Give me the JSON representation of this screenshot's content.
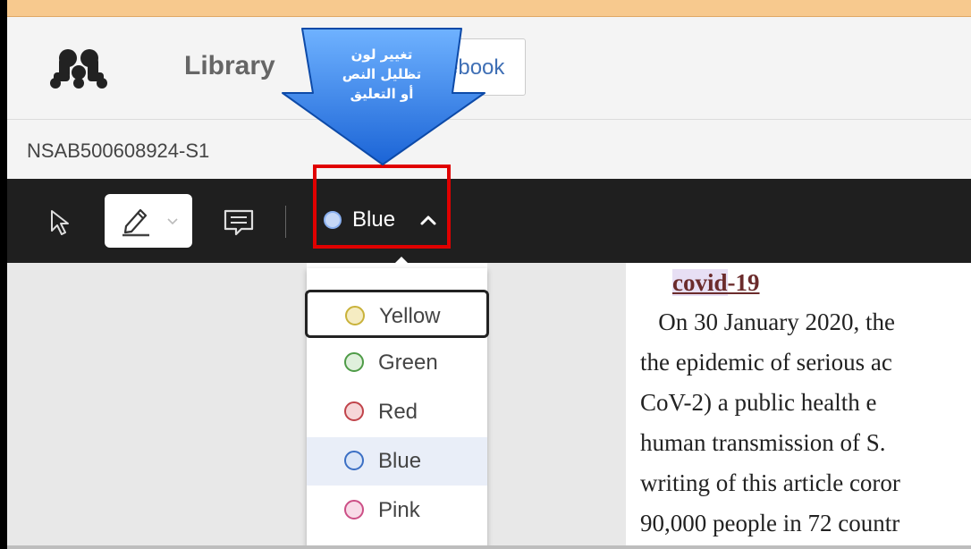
{
  "header": {
    "library_label": "Library",
    "notebook_label": "ebook"
  },
  "document": {
    "id": "NSAB500608924-S1",
    "title_part1": "covid",
    "title_part2": "-19",
    "lines": [
      "   On 30 January 2020, the",
      "the epidemic of serious ac",
      "CoV-2) a public health e",
      "human transmission of S.",
      "writing of this article coror",
      "90,000 people in 72 countr"
    ]
  },
  "toolbar": {
    "color_selected": "Blue",
    "accent_color": "#4f8ff0"
  },
  "color_menu": {
    "items": [
      {
        "label": "Yellow",
        "ring": "#c9b23a",
        "fill": "#f5ecc2"
      },
      {
        "label": "Green",
        "ring": "#4e9b47",
        "fill": "#dff0dc"
      },
      {
        "label": "Red",
        "ring": "#c0434a",
        "fill": "#f6d6d8"
      },
      {
        "label": "Blue",
        "ring": "#3b6fc4",
        "fill": "#dbe6f7"
      },
      {
        "label": "Pink",
        "ring": "#cc4f86",
        "fill": "#f8dbe8"
      }
    ]
  },
  "callout": {
    "line1": "تغيير لون",
    "line2": "تظليل النص",
    "line3": "أو التعليق"
  }
}
